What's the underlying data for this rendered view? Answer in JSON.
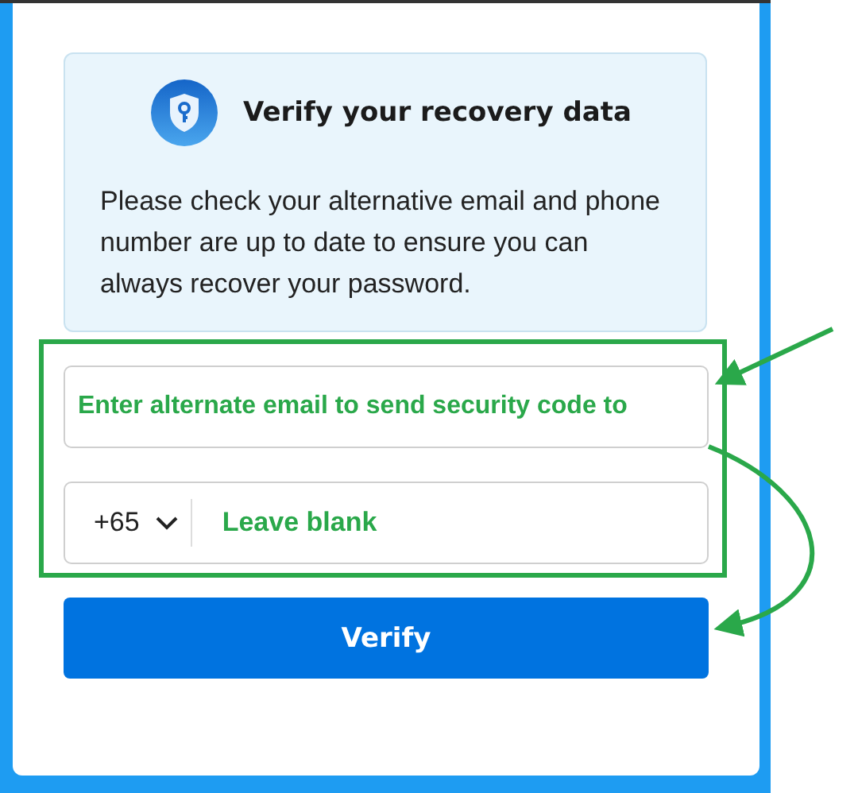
{
  "dialog": {
    "title": "Verify your recovery data",
    "message": "Please check your alternative email and phone number are up to date to ensure you can always recover your password.",
    "email_field": {
      "annotation": "Enter alternate email to send security code to"
    },
    "phone_field": {
      "country_code": "+65",
      "annotation": "Leave blank"
    },
    "button": "Verify"
  }
}
